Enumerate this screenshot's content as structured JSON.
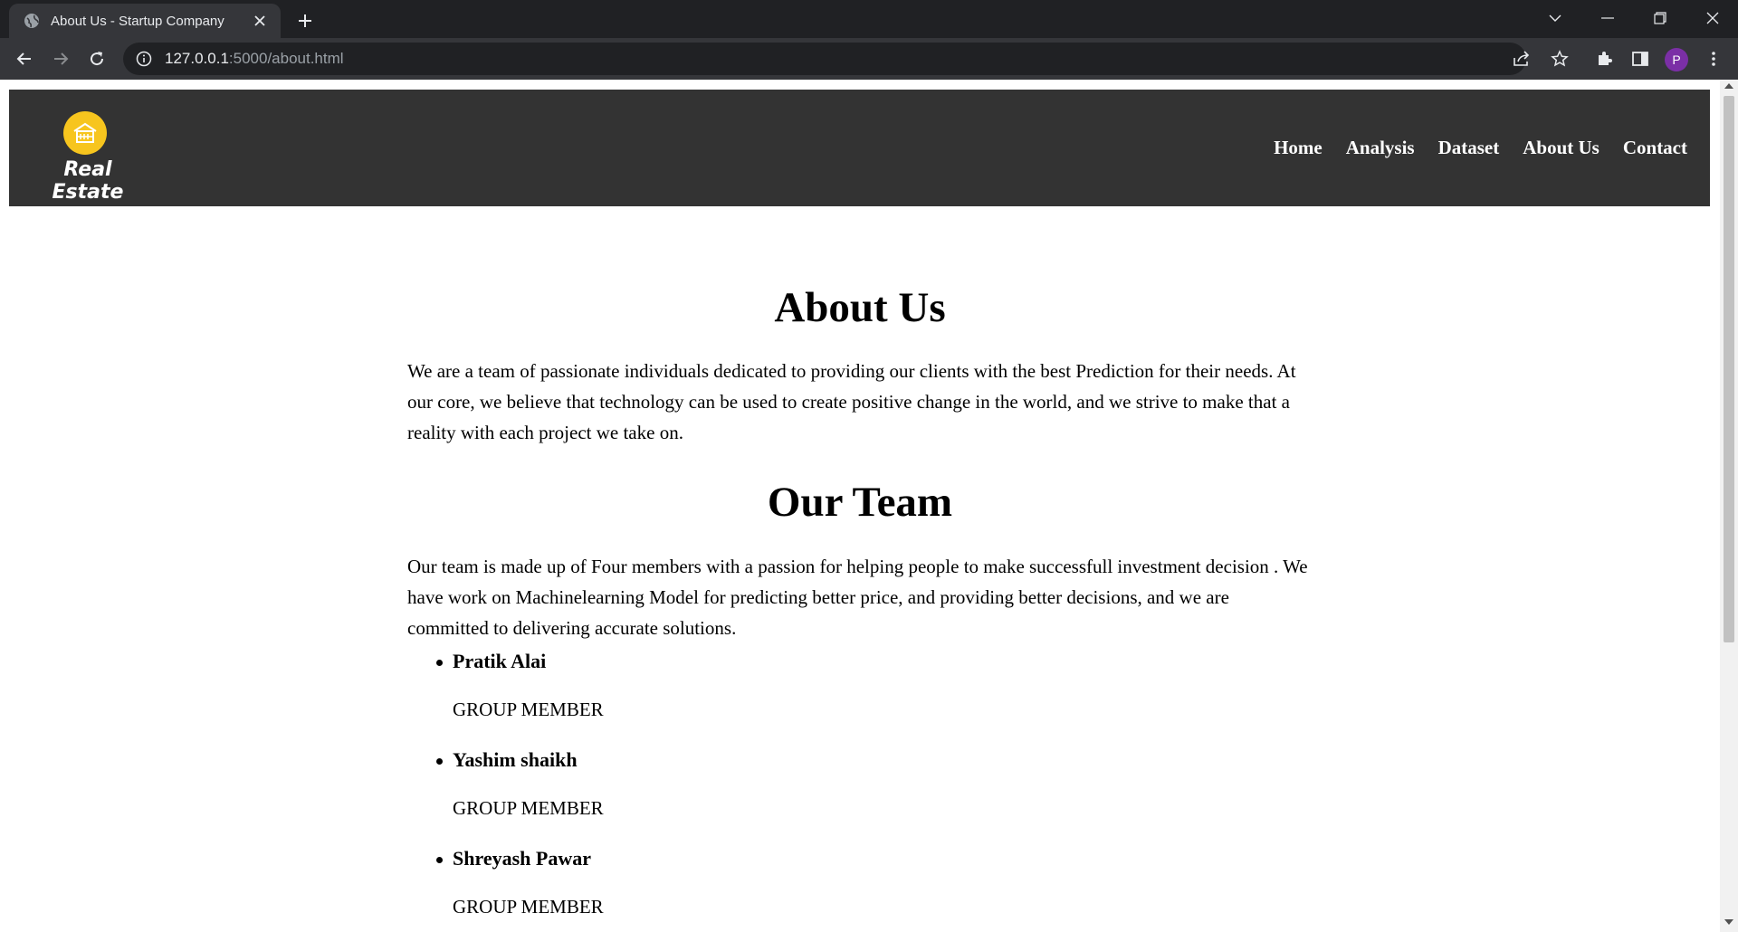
{
  "browser": {
    "tab_title": "About Us - Startup Company",
    "url_host": "127.0.0.1",
    "url_path": ":5000/about.html",
    "avatar_initial": "P"
  },
  "site": {
    "brand": "Real Estate",
    "nav": [
      "Home",
      "Analysis",
      "Dataset",
      "About Us",
      "Contact"
    ]
  },
  "about": {
    "heading": "About Us",
    "paragraph": "We are a team of passionate individuals dedicated to providing our clients with the best Prediction for their needs. At our core, we believe that technology can be used to create positive change in the world, and we strive to make that a reality with each project we take on."
  },
  "team": {
    "heading": "Our Team",
    "paragraph": "Our team is made up of Four members with a passion for helping people to make successfull investment decision . We have work on Machinelearning Model for predicting better price, and providing better decisions, and we are committed to delivering accurate solutions.",
    "members": [
      {
        "name": "Pratik Alai",
        "role": "GROUP MEMBER"
      },
      {
        "name": "Yashim shaikh",
        "role": "GROUP MEMBER"
      },
      {
        "name": "Shreyash Pawar",
        "role": "GROUP MEMBER"
      }
    ]
  }
}
